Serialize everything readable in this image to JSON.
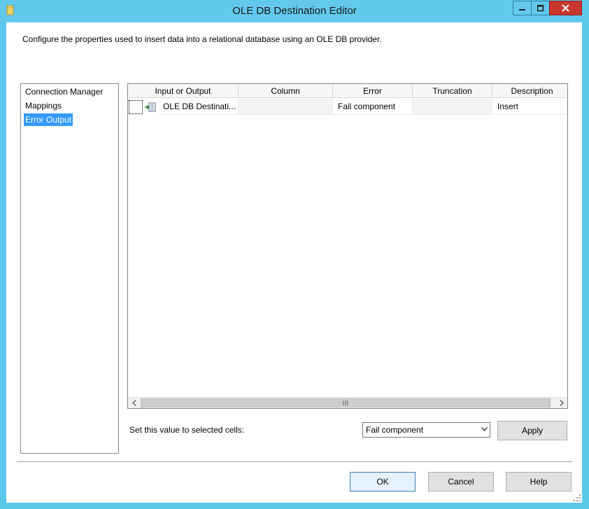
{
  "window": {
    "title": "OLE DB Destination Editor",
    "minimize_icon": "minimize-icon",
    "maximize_icon": "maximize-icon",
    "close_icon": "close-icon"
  },
  "description": "Configure the properties used to insert data into a relational database using an OLE DB provider.",
  "nav": {
    "items": [
      {
        "label": "Connection Manager",
        "selected": false
      },
      {
        "label": "Mappings",
        "selected": false
      },
      {
        "label": "Error Output",
        "selected": true
      }
    ]
  },
  "grid": {
    "columns": [
      "Input or Output",
      "Column",
      "Error",
      "Truncation",
      "Description"
    ],
    "rows": [
      {
        "input_or_output": "OLE DB Destinati...",
        "column": "",
        "error": "Fail component",
        "truncation": "",
        "description": "Insert",
        "icon": "input-table-icon"
      }
    ],
    "scroll_left_icon": "chevron-left-icon",
    "scroll_right_icon": "chevron-right-icon"
  },
  "set_value": {
    "label": "Set this value to selected cells:",
    "selected": "Fail component",
    "apply_label": "Apply"
  },
  "footer": {
    "ok_label": "OK",
    "cancel_label": "Cancel",
    "help_label": "Help"
  },
  "colors": {
    "titlebar": "#62c9ec",
    "selection": "#3399ff",
    "close_button": "#c7372f"
  }
}
